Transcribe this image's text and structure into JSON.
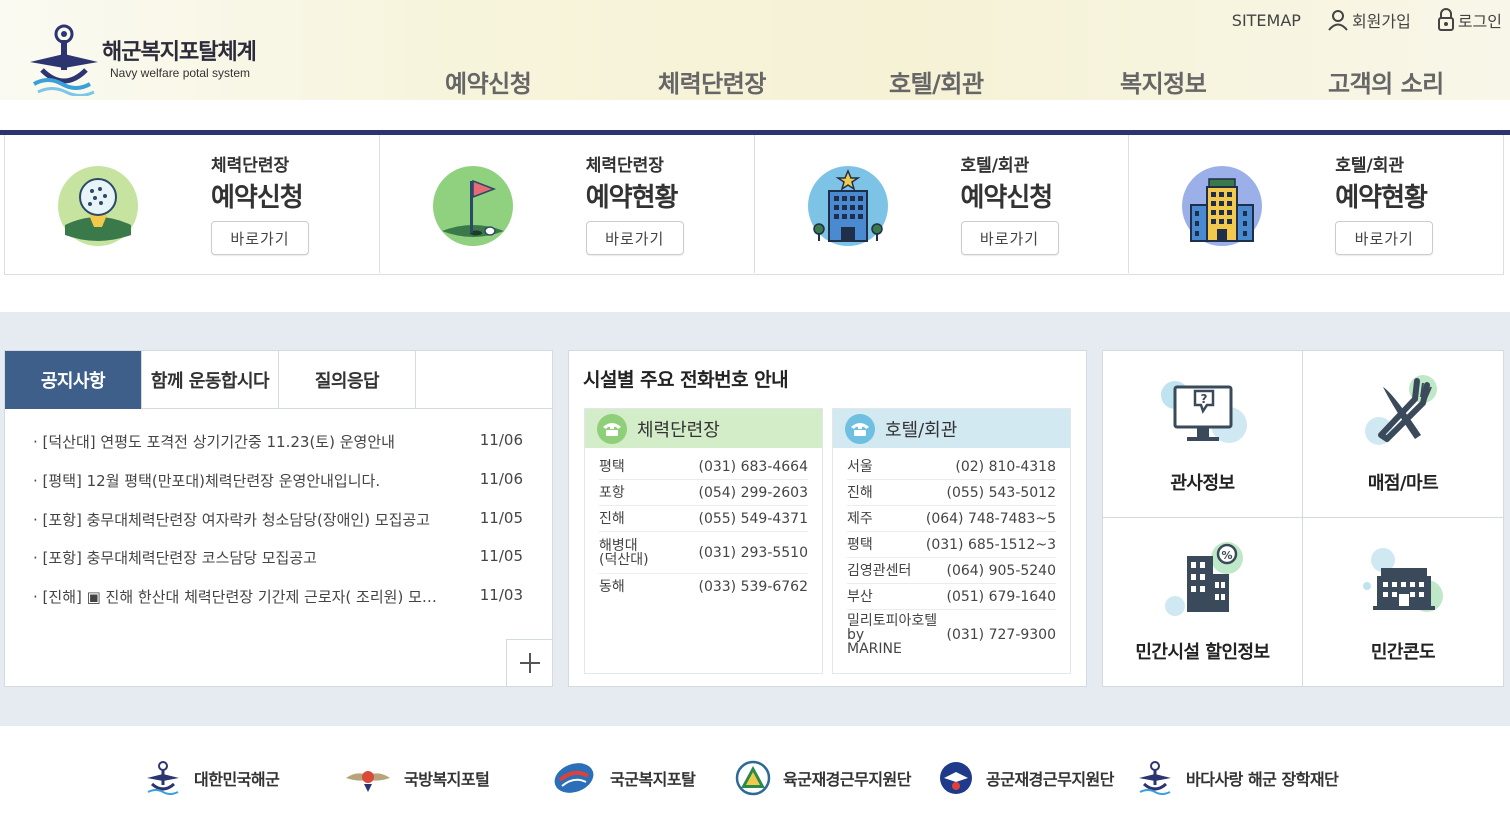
{
  "header": {
    "logo_title": "해군복지포탈체계",
    "logo_sub": "Navy welfare potal system",
    "util": {
      "sitemap": "SITEMAP",
      "join": "회원가입",
      "login": "로그인"
    },
    "nav": [
      "예약신청",
      "체력단련장",
      "호텔/회관",
      "복지정보",
      "고객의 소리"
    ]
  },
  "quick": [
    {
      "sub": "체력단련장",
      "main": "예약신청",
      "button": "바로가기",
      "icon": "golf-ball-icon"
    },
    {
      "sub": "체력단련장",
      "main": "예약현황",
      "button": "바로가기",
      "icon": "golf-flag-icon"
    },
    {
      "sub": "호텔/회관",
      "main": "예약신청",
      "button": "바로가기",
      "icon": "hotel-icon"
    },
    {
      "sub": "호텔/회관",
      "main": "예약현황",
      "button": "바로가기",
      "icon": "hotel-tower-icon"
    }
  ],
  "board": {
    "tabs": [
      "공지사항",
      "함께 운동합시다",
      "질의응답"
    ],
    "items": [
      {
        "title": "· [덕산대] 연평도 포격전 상기기간중 11.23(토) 운영안내",
        "date": "11/06"
      },
      {
        "title": "· [평택] 12월 평택(만포대)체력단련장 운영안내입니다.",
        "date": "11/06"
      },
      {
        "title": "· [포항] 충무대체력단련장 여자락카 청소담당(장애인) 모집공고",
        "date": "11/05"
      },
      {
        "title": "· [포항] 충무대체력단련장 코스담당 모집공고",
        "date": "11/05"
      },
      {
        "title": "· [진해] ▣ 진해 한산대 체력단련장 기간제 근로자( 조리원) 모집공고",
        "date": "11/03"
      }
    ]
  },
  "phone": {
    "title": "시설별 주요 전화번호 안내",
    "golf": {
      "label": "체력단련장",
      "rows": [
        {
          "name": "평택",
          "tel": "(031) 683-4664"
        },
        {
          "name": "포항",
          "tel": "(054) 299-2603"
        },
        {
          "name": "진해",
          "tel": "(055) 549-4371"
        },
        {
          "name": "해병대\n(덕산대)",
          "tel": "(031) 293-5510"
        },
        {
          "name": "동해",
          "tel": "(033) 539-6762"
        }
      ]
    },
    "hotel": {
      "label": "호텔/회관",
      "rows": [
        {
          "name": "서울",
          "tel": "(02) 810-4318"
        },
        {
          "name": "진해",
          "tel": "(055) 543-5012"
        },
        {
          "name": "제주",
          "tel": "(064) 748-7483~5"
        },
        {
          "name": "평택",
          "tel": "(031) 685-1512~3"
        },
        {
          "name": "김영관센터",
          "tel": "(064) 905-5240"
        },
        {
          "name": "부산",
          "tel": "(051) 679-1640"
        },
        {
          "name": "밀리토피아호텔\nby\nMARINE",
          "tel": "(031) 727-9300"
        }
      ]
    }
  },
  "links": [
    {
      "label": "관사정보",
      "icon": "computer-help-icon"
    },
    {
      "label": "매점/마트",
      "icon": "knife-fork-icon"
    },
    {
      "label": "민간시설 할인정보",
      "icon": "building-discount-icon"
    },
    {
      "label": "민간콘도",
      "icon": "condo-icon"
    }
  ],
  "footer_links": [
    {
      "label": "대한민국해군",
      "icon": "navy-emblem-icon"
    },
    {
      "label": "국방복지포털",
      "icon": "mnd-emblem-icon"
    },
    {
      "label": "국군복지포탈",
      "icon": "welfare-portal-icon"
    },
    {
      "label": "육군재경근무지원단",
      "icon": "army-emblem-icon"
    },
    {
      "label": "공군재경근무지원단",
      "icon": "airforce-emblem-icon"
    },
    {
      "label": "바다사랑 해군 장학재단",
      "icon": "navy-scholarship-icon"
    }
  ],
  "colors": {
    "navy": "#2c3570",
    "tab_active": "#3d5f89",
    "mid_bg": "#e6ebf2"
  }
}
